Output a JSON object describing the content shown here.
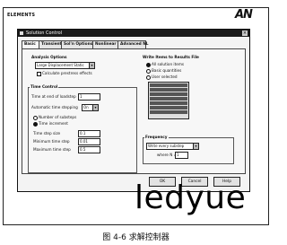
{
  "header_label": "ELEMENTS",
  "logo_text": "AN",
  "dialog": {
    "title": "Solution Control",
    "close_glyph": "×",
    "tabs": [
      "Basic",
      "Transient",
      "Sol'n Options",
      "Nonlinear",
      "Advanced NL"
    ],
    "analysis_options": {
      "heading": "Analysis Options",
      "type_value": "Large Displacement Static",
      "calc_prestress": "Calculate prestress effects"
    },
    "time_control": {
      "heading": "Time Control",
      "time_end_label": "Time at end of loadstep",
      "time_end_value": "1",
      "auto_time_label": "Automatic time stepping",
      "auto_time_value": "On",
      "num_substeps": "Number of substeps",
      "time_increment": "Time increment",
      "time_step_size_label": "Time step size",
      "time_step_size_value": "0.1",
      "min_step_label": "Minimum time step",
      "min_step_value": "0.01",
      "max_step_label": "Maximum time step",
      "max_step_value": "0.5"
    },
    "write_items": {
      "heading": "Write Items to Results File",
      "all_items": "All solution items",
      "basic_quantities": "Basic quantities",
      "user_selected": "User selected"
    },
    "frequency": {
      "heading": "Frequency",
      "value": "Write every substep",
      "where_label": "where N =",
      "where_value": "1"
    },
    "buttons": {
      "ok": "OK",
      "cancel": "Cancel",
      "help": "Help"
    }
  },
  "watermark": "ledyue",
  "caption": "图 4-6   求解控制器"
}
